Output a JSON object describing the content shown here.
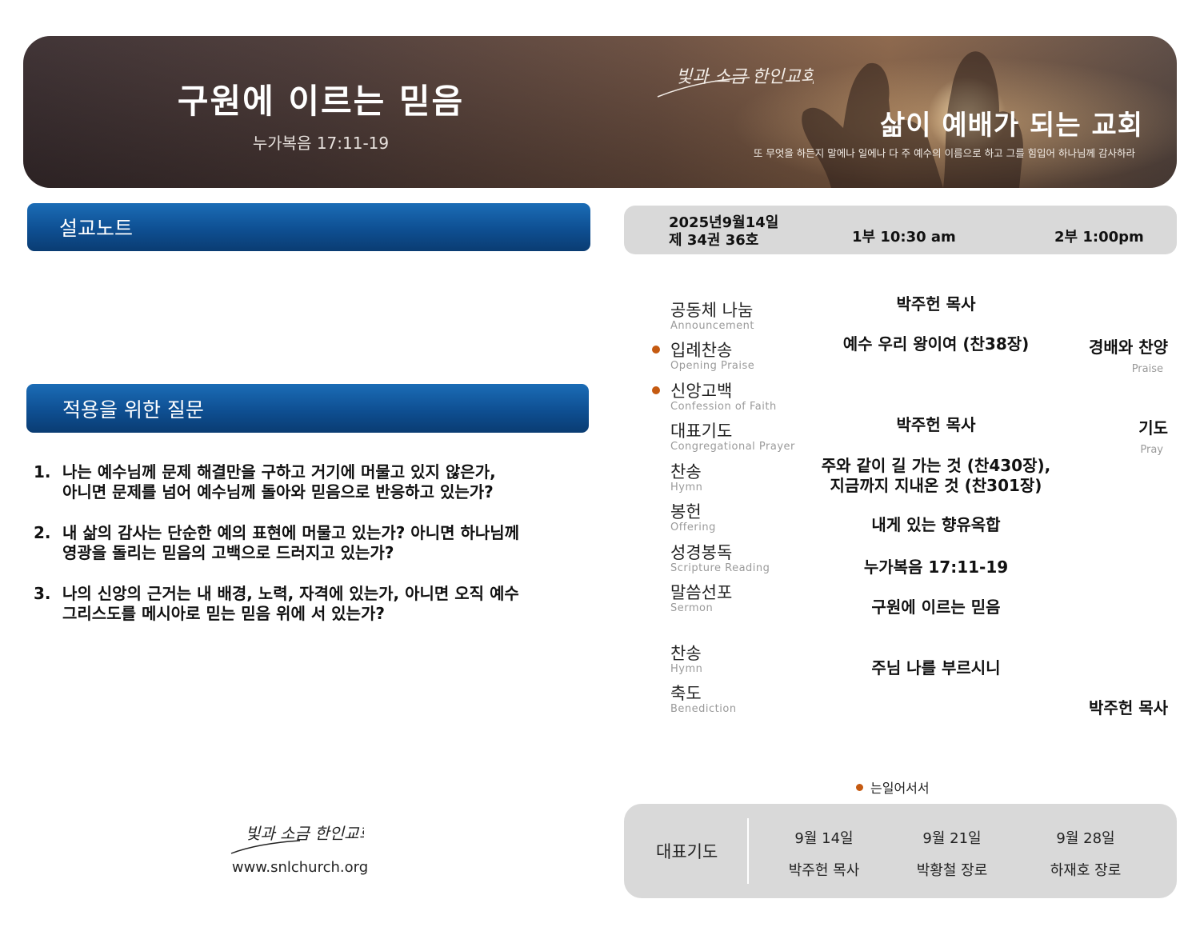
{
  "banner": {
    "title": "구원에 이르는 믿음",
    "scripture": "누가복음 17:11-19",
    "church_logo": "빛과 소금 한인교회",
    "motto": "삶이 예배가 되는 교회",
    "verse": "또 무엇을 하든지 말에나 일에나 다 주 예수의 이름으로 하고 그를 힘입어 하나님께 감사하라"
  },
  "sections": {
    "notes_title": "설교노트",
    "questions_title": "적용을 위한 질문"
  },
  "questions": [
    {
      "num": "1.",
      "text": "나는 예수님께 문제 해결만을 구하고 거기에 머물고 있지 않은가,\n아니면 문제를 넘어 예수님께 돌아와 믿음으로 반응하고 있는가?"
    },
    {
      "num": "2.",
      "text": "내 삶의 감사는 단순한 예의 표현에 머물고 있는가? 아니면 하나님께\n영광을 돌리는 믿음의 고백으로 드러지고 있는가?"
    },
    {
      "num": "3.",
      "text": "나의 신앙의 근거는 내 배경, 노력, 자격에 있는가, 아니면 오직 예수\n그리스도를 메시아로 믿는 믿음 위에 서 있는가?"
    }
  ],
  "footer": {
    "logo": "빛과 소금 한인교회",
    "url": "www.snlchurch.org"
  },
  "datebar": {
    "date": "2025년9월14일",
    "volume": "제 34권 36호",
    "service1": "1부 10:30 am",
    "service2": "2부 1:00pm"
  },
  "order": [
    {
      "ko": "공동체 나눔",
      "en": "Announcement",
      "content": "박주헌 목사",
      "standing": false
    },
    {
      "ko": "입례찬송",
      "en": "Opening Praise",
      "content": "예수 우리 왕이여 (찬38장)",
      "right_ko": "경배와 찬양",
      "right_en": "Praise",
      "standing": true
    },
    {
      "ko": "신앙고백",
      "en": "Confession of Faith",
      "content": "",
      "standing": true
    },
    {
      "ko": "대표기도",
      "en": "Congregational Prayer",
      "content": "박주헌 목사",
      "right_ko": "기도",
      "right_en": "Pray",
      "standing": false
    },
    {
      "ko": "찬송",
      "en": "Hymn",
      "content": "주와 같이 길 가는 것 (찬430장),\n지금까지 지내온 것 (찬301장)",
      "standing": false
    },
    {
      "ko": "봉헌",
      "en": "Offering",
      "content": "내게 있는 향유옥합",
      "standing": false
    },
    {
      "ko": "성경봉독",
      "en": "Scripture Reading",
      "content": "누가복음 17:11-19",
      "standing": false
    },
    {
      "ko": "말씀선포",
      "en": "Sermon",
      "content": "구원에 이르는 믿음",
      "standing": false
    },
    {
      "ko": "찬송",
      "en": "Hymn",
      "content": "주님 나를 부르시니",
      "standing": false
    },
    {
      "ko": "축도",
      "en": "Benediction",
      "content": "",
      "right_ko": "박주헌 목사",
      "standing": false
    }
  ],
  "standing_note": "는일어서서",
  "prayer_schedule": {
    "label": "대표기도",
    "entries": [
      {
        "date": "9월 14일",
        "name": "박주헌 목사"
      },
      {
        "date": "9월 21일",
        "name": "박황철 장로"
      },
      {
        "date": "9월 28일",
        "name": "하재호 장로"
      }
    ]
  },
  "colors": {
    "header_blue": "#0e4f92",
    "accent_dot": "#c55a11",
    "panel_gray": "#d9d9d9"
  }
}
